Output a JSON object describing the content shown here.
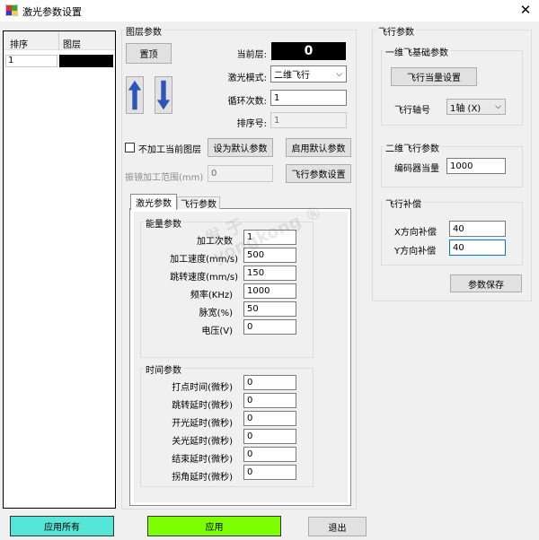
{
  "window": {
    "title": "激光参数设置"
  },
  "layer_table": {
    "headers": [
      "排序",
      "图层"
    ],
    "rows": [
      {
        "order": "1",
        "layer": ""
      }
    ]
  },
  "layer_params": {
    "title": "图层参数",
    "top_button": "置顶",
    "current_layer_label": "当前层:",
    "current_layer_value": "0",
    "laser_mode_label": "激光模式:",
    "laser_mode_value": "二维飞行",
    "loop_count_label": "循环次数:",
    "loop_count_value": "1",
    "sort_no_label": "排序号:",
    "sort_no_value": "1",
    "skip_layer_label": "不加工当前图层",
    "set_default_button": "设为默认参数",
    "enable_default_button": "启用默认参数",
    "galvo_range_label": "振镜加工范围(mm)",
    "galvo_range_value": "0",
    "fly_param_button": "飞行参数设置"
  },
  "tabs": {
    "laser": "激光参数",
    "fly": "飞行参数"
  },
  "energy": {
    "title": "能量参数",
    "rows": [
      {
        "label": "加工次数",
        "value": "1"
      },
      {
        "label": "加工速度(mm/s)",
        "value": "500"
      },
      {
        "label": "跳转速度(mm/s)",
        "value": "150"
      },
      {
        "label": "频率(KHz)",
        "value": "1000"
      },
      {
        "label": "脉宽(%)",
        "value": "50"
      },
      {
        "label": "电压(V)",
        "value": "0"
      }
    ]
  },
  "timing": {
    "title": "时间参数",
    "rows": [
      {
        "label": "打点时间(微秒)",
        "value": "0"
      },
      {
        "label": "跳转延时(微秒)",
        "value": "0"
      },
      {
        "label": "开光延时(微秒)",
        "value": "0"
      },
      {
        "label": "关光延时(微秒)",
        "value": "0"
      },
      {
        "label": "结束延时(微秒)",
        "value": "0"
      },
      {
        "label": "拐角延时(微秒)",
        "value": "0"
      }
    ]
  },
  "flight": {
    "title": "飞行参数",
    "basic_title": "一维飞基础参数",
    "set_equiv_button": "飞行当量设置",
    "axis_label": "飞行轴号",
    "axis_value": "1轴 (X)",
    "two_d_title": "二维飞行参数",
    "encoder_label": "编码器当量",
    "encoder_value": "1000",
    "comp_title": "飞行补偿",
    "x_comp_label": "X方向补偿",
    "x_comp_value": "40",
    "y_comp_label": "Y方向补偿",
    "y_comp_value": "40",
    "save_button": "参数保存"
  },
  "watermark": {
    "text": "发 于\nyongkong ®"
  },
  "bottom": {
    "apply_all": "应用所有",
    "apply": "应用",
    "exit": "退出"
  },
  "colors": {
    "apply_all_bg": "#55e6d8",
    "apply_bg": "#7dff00",
    "arrow_blue": "#2c55b7",
    "current_layer_bg": "#000000"
  }
}
